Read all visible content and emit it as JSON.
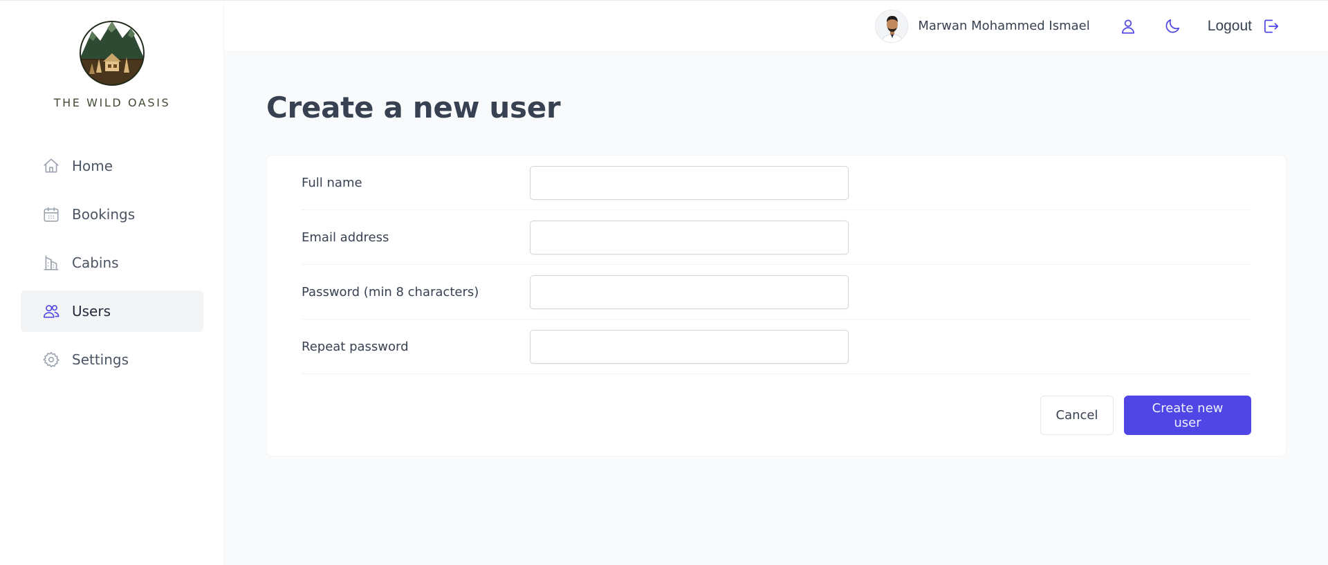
{
  "brand": {
    "name": "THE WILD OASIS"
  },
  "sidebar": {
    "items": [
      {
        "label": "Home",
        "icon": "home-icon",
        "active": false
      },
      {
        "label": "Bookings",
        "icon": "calendar-icon",
        "active": false
      },
      {
        "label": "Cabins",
        "icon": "building-icon",
        "active": false
      },
      {
        "label": "Users",
        "icon": "users-icon",
        "active": true
      },
      {
        "label": "Settings",
        "icon": "gear-icon",
        "active": false
      }
    ]
  },
  "header": {
    "user_name": "Marwan Mohammed Ismael",
    "logout_label": "Logout",
    "icons": [
      "user-icon",
      "moon-icon",
      "logout-icon"
    ]
  },
  "main": {
    "title": "Create a new user",
    "form": {
      "fields": [
        {
          "label": "Full name",
          "value": "",
          "placeholder": ""
        },
        {
          "label": "Email address",
          "value": "",
          "placeholder": ""
        },
        {
          "label": "Password (min 8 characters)",
          "value": "",
          "placeholder": ""
        },
        {
          "label": "Repeat password",
          "value": "",
          "placeholder": ""
        }
      ],
      "cancel_label": "Cancel",
      "submit_label": "Create new user"
    }
  },
  "colors": {
    "accent": "#4f46e5",
    "background": "#f9fafb",
    "surface": "#ffffff",
    "text": "#374151"
  }
}
